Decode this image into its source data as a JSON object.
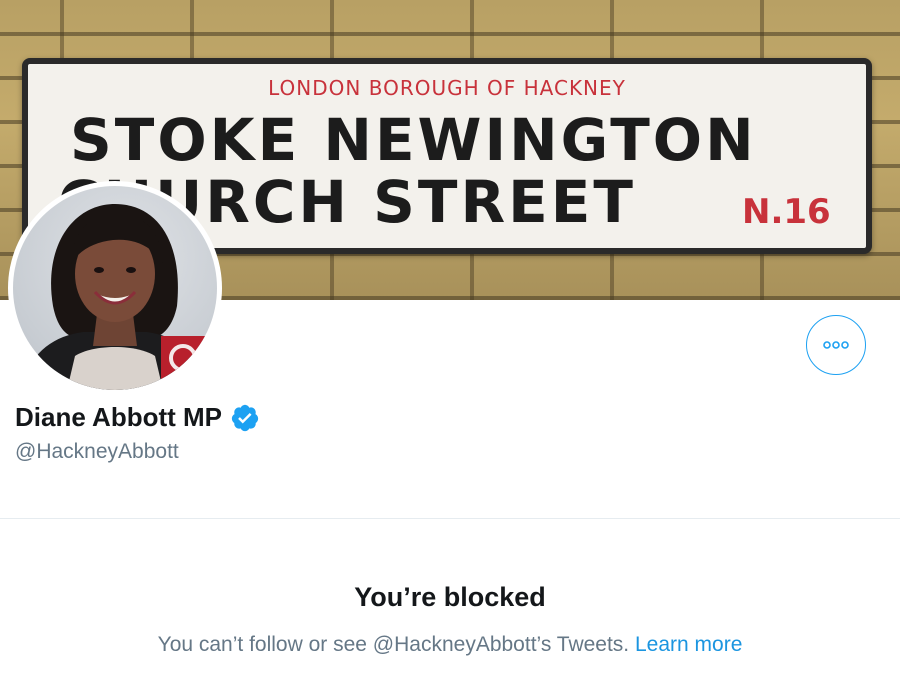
{
  "banner": {
    "sign_borough": "LONDON BOROUGH OF HACKNEY",
    "sign_line1": "STOKE NEWINGTON",
    "sign_line2": "CHURCH STREET",
    "sign_code": "N.16"
  },
  "profile": {
    "display_name": "Diane Abbott MP",
    "handle": "@HackneyAbbott",
    "verified": true,
    "avatar_icon": "profile-photo"
  },
  "actions": {
    "more_icon": "more-options-icon"
  },
  "blocked": {
    "title": "You’re blocked",
    "message": "You can’t follow or see @HackneyAbbott’s Tweets. ",
    "learn_more": "Learn more"
  },
  "colors": {
    "accent": "#1da1f2",
    "link": "#1b95e0",
    "secondary_text": "#657786",
    "primary_text": "#14171a",
    "sign_red": "#c8323b"
  }
}
